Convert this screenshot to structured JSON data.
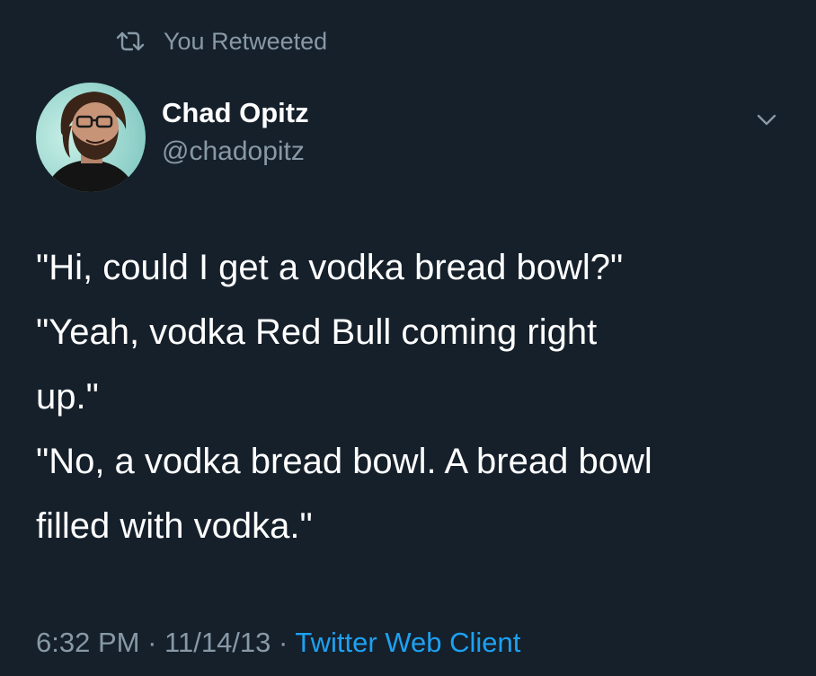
{
  "retweet": {
    "label": "You Retweeted",
    "icon": "retweet-icon"
  },
  "author": {
    "name": "Chad Opitz",
    "handle": "@chadopitz",
    "avatar": "avatar"
  },
  "tweet": {
    "lines": [
      "\"Hi, could I get a vodka bread bowl?\"",
      "\"Yeah, vodka Red Bull coming right",
      "up.\"",
      "\"No, a vodka bread bowl. A bread bowl",
      "filled with vodka.\""
    ]
  },
  "meta": {
    "time": "6:32 PM",
    "separator": "·",
    "date": "11/14/13",
    "client": "Twitter Web Client"
  },
  "colors": {
    "background": "#15202b",
    "text": "#ffffff",
    "secondary": "#8899a6",
    "link": "#1da1f2"
  }
}
